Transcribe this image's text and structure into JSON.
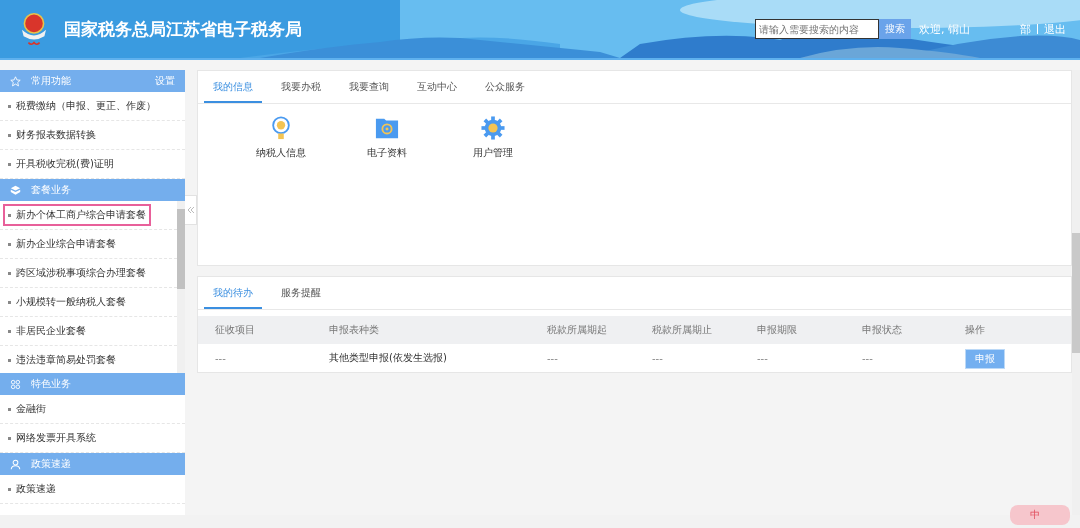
{
  "header": {
    "title": "国家税务总局江苏省电子税务局",
    "search": {
      "placeholder": "请输入需要搜索的内容"
    },
    "search_button": "搜索",
    "welcome": "欢迎, 铜山",
    "links": [
      "部",
      "退出"
    ]
  },
  "sidebar": {
    "sections": [
      {
        "title": "常用功能",
        "kind": "star",
        "action": "设置",
        "scrollable": false,
        "items": [
          {
            "label": "税费缴纳（申报、更正、作废）",
            "highlighted": false
          },
          {
            "label": "财务报表数据转换",
            "highlighted": false
          },
          {
            "label": "开具税收完税(费)证明",
            "highlighted": false
          }
        ]
      },
      {
        "title": "套餐业务",
        "kind": "cube",
        "scrollable": true,
        "items": [
          {
            "label": "新办个体工商户综合申请套餐",
            "highlighted": true
          },
          {
            "label": "新办企业综合申请套餐",
            "highlighted": false
          },
          {
            "label": "跨区域涉税事项综合办理套餐",
            "highlighted": false
          },
          {
            "label": "小规模转一般纳税人套餐",
            "highlighted": false
          },
          {
            "label": "非居民企业套餐",
            "highlighted": false
          },
          {
            "label": "违法违章简易处罚套餐",
            "highlighted": false
          }
        ]
      },
      {
        "title": "特色业务",
        "kind": "grid",
        "scrollable": false,
        "items": [
          {
            "label": "金融街",
            "highlighted": false
          },
          {
            "label": "网络发票开具系统",
            "highlighted": false
          }
        ]
      },
      {
        "title": "政策速递",
        "kind": "person",
        "scrollable": false,
        "items": [
          {
            "label": "政策速递",
            "highlighted": false
          }
        ]
      }
    ]
  },
  "info_panel": {
    "tabs": [
      {
        "label": "我的信息",
        "selected": true
      },
      {
        "label": "我要办税",
        "selected": false
      },
      {
        "label": "我要查询",
        "selected": false
      },
      {
        "label": "互动中心",
        "selected": false
      },
      {
        "label": "公众服务",
        "selected": false
      }
    ],
    "tiles": [
      {
        "label": "纳税人信息",
        "kind": "badge"
      },
      {
        "label": "电子资料",
        "kind": "folder"
      },
      {
        "label": "用户管理",
        "kind": "gear"
      }
    ]
  },
  "todo_panel": {
    "tabs": [
      {
        "label": "我的待办",
        "selected": true
      },
      {
        "label": "服务提醒",
        "selected": false
      }
    ],
    "table": {
      "columns": [
        "征收项目",
        "申报表种类",
        "税款所属期起",
        "税款所属期止",
        "申报期限",
        "申报状态",
        "操作"
      ],
      "rows": [
        {
          "cells": [
            "---",
            "其他类型申报(依发生选报)",
            "---",
            "---",
            "---",
            "---"
          ],
          "action": "申报"
        }
      ]
    }
  },
  "status_bar": {
    "ime": "中"
  }
}
